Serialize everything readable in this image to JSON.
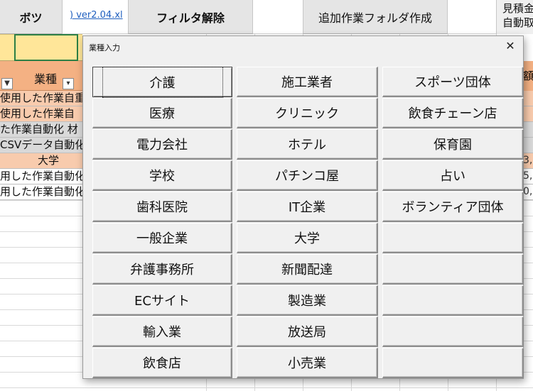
{
  "toolbar": {
    "bots_label": "ボツ",
    "file_link": ") ver2.04.xl",
    "filter_clear_label": "フィルタ解除",
    "create_folder_label": "追加作業フォルダ作成",
    "estimate_line1": "見積金",
    "estimate_line2": "自動取"
  },
  "sheet": {
    "header_label": "業種",
    "right_header": "額",
    "rows": [
      {
        "text": "使用した作業自重",
        "right": ""
      },
      {
        "text": "使用した作業自",
        "right": ""
      },
      {
        "text": "た作業自動化 材",
        "right": ""
      },
      {
        "text": "CSVデータ自動化",
        "right": ""
      },
      {
        "text": "大学",
        "right": "3,"
      },
      {
        "text": "用した作業自動化",
        "right": "5,"
      },
      {
        "text": "用した作業自動化",
        "right": "0,"
      }
    ]
  },
  "dialog": {
    "title": "業種入力",
    "close_symbol": "✕",
    "buttons": [
      "介護",
      "施工業者",
      "スポーツ団体",
      "医療",
      "クリニック",
      "飲食チェーン店",
      "電力会社",
      "ホテル",
      "保育園",
      "学校",
      "パチンコ屋",
      "占い",
      "歯科医院",
      "IT企業",
      "ボランティア団体",
      "一般企業",
      "大学",
      "",
      "弁護事務所",
      "新聞配達",
      "",
      "ECサイト",
      "製造業",
      "",
      "輸入業",
      "放送局",
      "",
      "飲食店",
      "小売業",
      ""
    ]
  }
}
